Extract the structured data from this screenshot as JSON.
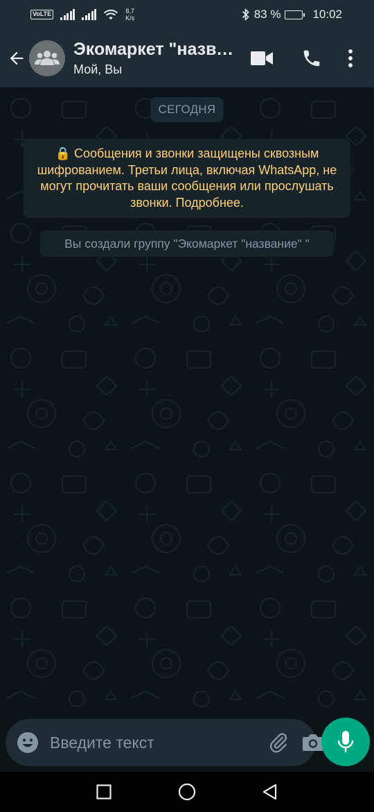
{
  "status_bar": {
    "volte": "VoLTE",
    "speed_value": "8,7",
    "speed_unit": "K/s",
    "battery_percent": "83 %",
    "battery_level": 0.83,
    "time": "10:02"
  },
  "header": {
    "title": "Экомаркет \"название\" ",
    "subtitle": "Мой, Вы"
  },
  "chat": {
    "date_chip": "СЕГОДНЯ",
    "encryption_notice": "🔒 Сообщения и звонки защищены сквозным шифрованием. Третьи лица, включая WhatsApp, не могут прочитать ваши сообщения или прослушать звонки. Подробнее.",
    "system_message": "Вы создали группу \"Экомаркет \"название\" \""
  },
  "input": {
    "placeholder": "Введите текст"
  },
  "colors": {
    "header_bg": "#1f2c34",
    "chat_bg": "#0b141a",
    "accent": "#00a884",
    "notice_text": "#ffd279"
  },
  "icons": {
    "back": "arrow-left-icon",
    "avatar": "group-icon",
    "video": "video-camera-icon",
    "call": "phone-icon",
    "menu": "more-vertical-icon",
    "emoji": "emoji-icon",
    "attach": "paperclip-icon",
    "camera": "camera-icon",
    "mic": "microphone-icon"
  }
}
